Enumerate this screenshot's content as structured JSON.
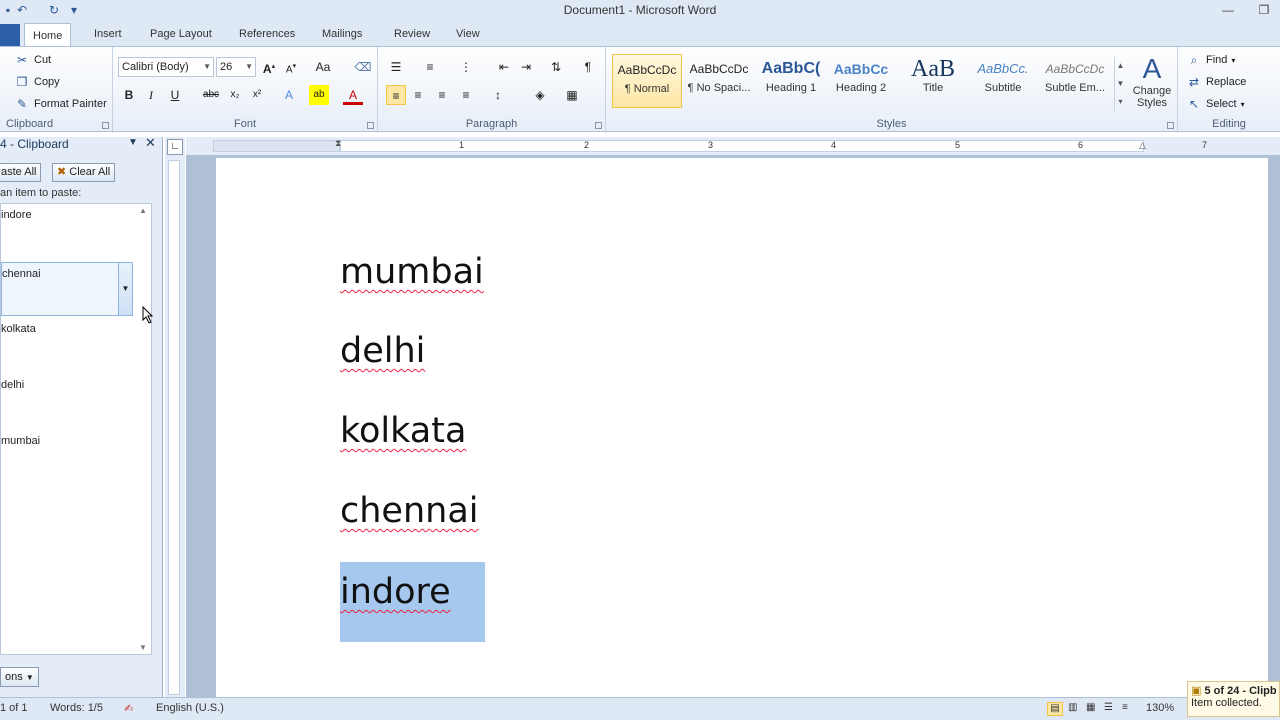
{
  "window": {
    "title": "Document1  -  Microsoft Word"
  },
  "quick_access": {
    "icons": [
      "save-icon",
      "undo-icon",
      "redo-icon",
      "customize-icon"
    ]
  },
  "tabs": [
    {
      "label": "Home",
      "active": true
    },
    {
      "label": "Insert"
    },
    {
      "label": "Page Layout"
    },
    {
      "label": "References"
    },
    {
      "label": "Mailings"
    },
    {
      "label": "Review"
    },
    {
      "label": "View"
    }
  ],
  "ribbon": {
    "clipboard": {
      "label": "Clipboard",
      "cut": "Cut",
      "copy": "Copy",
      "format_painter": "Format Painter"
    },
    "font": {
      "label": "Font",
      "family": "Calibri (Body)",
      "size": "26"
    },
    "paragraph": {
      "label": "Paragraph"
    },
    "styles": {
      "label": "Styles",
      "items": [
        {
          "preview": "AaBbCcDc",
          "name": "¶ Normal"
        },
        {
          "preview": "AaBbCcDc",
          "name": "¶ No Spaci..."
        },
        {
          "preview": "AaBbC(",
          "name": "Heading 1"
        },
        {
          "preview": "AaBbCc",
          "name": "Heading 2"
        },
        {
          "preview": "AaB",
          "name": "Title"
        },
        {
          "preview": "AaBbCc.",
          "name": "Subtitle"
        },
        {
          "preview": "AaBbCcDc",
          "name": "Subtle Em..."
        }
      ],
      "change_styles": "Change Styles"
    },
    "editing": {
      "label": "Editing",
      "find": "Find",
      "replace": "Replace",
      "select": "Select"
    }
  },
  "clipboard_pane": {
    "title": "4 - Clipboard",
    "paste_all": "aste All",
    "clear_all": "Clear All",
    "hint": "an item to paste:",
    "items": [
      "indore",
      "chennai",
      "kolkata",
      "delhi",
      "mumbai"
    ],
    "options": "ons"
  },
  "document": {
    "lines": [
      "mumbai",
      "delhi",
      "kolkata",
      "chennai",
      "indore"
    ],
    "ruler_numbers": [
      "1",
      "1",
      "2",
      "3",
      "4",
      "5",
      "6",
      "7"
    ]
  },
  "status": {
    "page": " 1 of 1",
    "words": "Words: 1/5",
    "language": "English (U.S.)",
    "zoom": "130%"
  },
  "notification": {
    "title": "5 of 24 - Clipb",
    "text": "Item collected."
  }
}
